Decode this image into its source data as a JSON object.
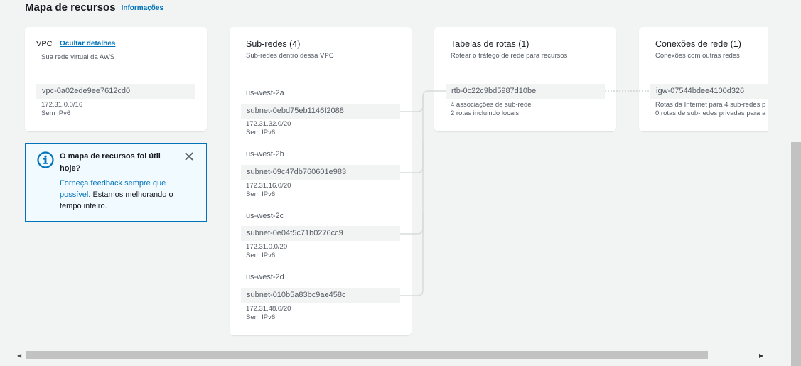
{
  "header": {
    "title": "Mapa de recursos",
    "info_link": "Informações"
  },
  "vpc": {
    "label": "VPC",
    "hide_details": "Ocultar detalhes",
    "description": "Sua rede virtual da AWS",
    "id": "vpc-0a02ede9ee7612cd0",
    "cidr": "172.31.0.0/16",
    "ipv6": "Sem IPv6"
  },
  "feedback": {
    "title": "O mapa de recursos foi útil hoje?",
    "link": "Forneça feedback sempre que possível",
    "body_rest": ". Estamos melhorando o tempo inteiro."
  },
  "subnets": {
    "title": "Sub-redes (4)",
    "description": "Sub-redes dentro dessa VPC",
    "items": [
      {
        "az": "us-west-2a",
        "id": "subnet-0ebd75eb1146f2088",
        "cidr": "172.31.32.0/20",
        "ipv6": "Sem IPv6"
      },
      {
        "az": "us-west-2b",
        "id": "subnet-09c47db760601e983",
        "cidr": "172.31.16.0/20",
        "ipv6": "Sem IPv6"
      },
      {
        "az": "us-west-2c",
        "id": "subnet-0e04f5c71b0276cc9",
        "cidr": "172.31.0.0/20",
        "ipv6": "Sem IPv6"
      },
      {
        "az": "us-west-2d",
        "id": "subnet-010b5a83bc9ae458c",
        "cidr": "172.31.48.0/20",
        "ipv6": "Sem IPv6"
      }
    ]
  },
  "route_tables": {
    "title": "Tabelas de rotas (1)",
    "description": "Rotear o tráfego de rede para recursos",
    "id": "rtb-0c22c9bd5987d10be",
    "associations": "4 associações de sub-rede",
    "routes": "2 rotas incluindo locais"
  },
  "network_connections": {
    "title": "Conexões de rede (1)",
    "description": "Conexões com outras redes",
    "id": "igw-07544bdee4100d326",
    "line1": "Rotas da Internet para 4 sub-redes p",
    "line2": "0 rotas de sub-redes privadas para a"
  },
  "colors": {
    "link": "#0073bb",
    "background": "#f2f3f3",
    "pill": "#f2f3f3",
    "connector": "#d5dbdb"
  },
  "icons": {
    "info": "info-circle-icon",
    "close": "close-icon",
    "scroll_left": "triangle-left-icon",
    "scroll_right": "triangle-right-icon"
  }
}
